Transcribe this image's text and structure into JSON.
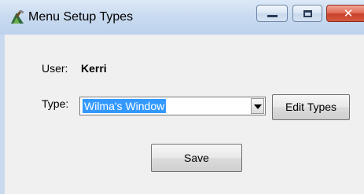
{
  "window": {
    "title": "Menu Setup Types",
    "title_icon": "hammer-tools-icon",
    "controls": {
      "minimize_icon": "minimize-icon",
      "maximize_icon": "maximize-icon",
      "close_icon": "close-icon",
      "close_glyph": "✕"
    }
  },
  "form": {
    "user_label": "User:",
    "user_value": "Kerri",
    "type_label": "Type:",
    "type_selected": "Wilma's Window",
    "edit_types_label": "Edit Types",
    "save_label": "Save"
  },
  "colors": {
    "selection": "#3399ff",
    "close_button": "#c9402a",
    "titlebar": "#c7d9ef"
  }
}
